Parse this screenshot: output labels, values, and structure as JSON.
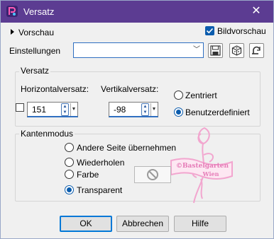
{
  "window": {
    "title": "Versatz",
    "close_glyph": "✕"
  },
  "top": {
    "preview_label": "Vorschau",
    "image_preview_label": "Bildvorschau",
    "image_preview_checked": true
  },
  "settings": {
    "label": "Einstellungen",
    "value": "",
    "icons": [
      "save-icon",
      "randomize-icon",
      "reset-icon"
    ]
  },
  "offset": {
    "group_label": "Versatz",
    "horizontal_label": "Horizontalversatz:",
    "vertical_label": "Vertikalversatz:",
    "horizontal_value": "151",
    "vertical_value": "-98",
    "centered_label": "Zentriert",
    "custom_label": "Benutzerdefiniert",
    "selected": "custom"
  },
  "edge_mode": {
    "group_label": "Kantenmodus",
    "options": [
      "Andere Seite übernehmen",
      "Wiederholen",
      "Farbe",
      "Transparent"
    ],
    "selected": "Transparent"
  },
  "watermark": {
    "lines": [
      "©Bastelgarten",
      "Wien"
    ],
    "color": "#f2a6cf"
  },
  "buttons": {
    "ok": "OK",
    "cancel": "Abbrechen",
    "help": "Hilfe"
  },
  "colors": {
    "titlebar": "#5c3c92",
    "accent": "#0078d7"
  }
}
